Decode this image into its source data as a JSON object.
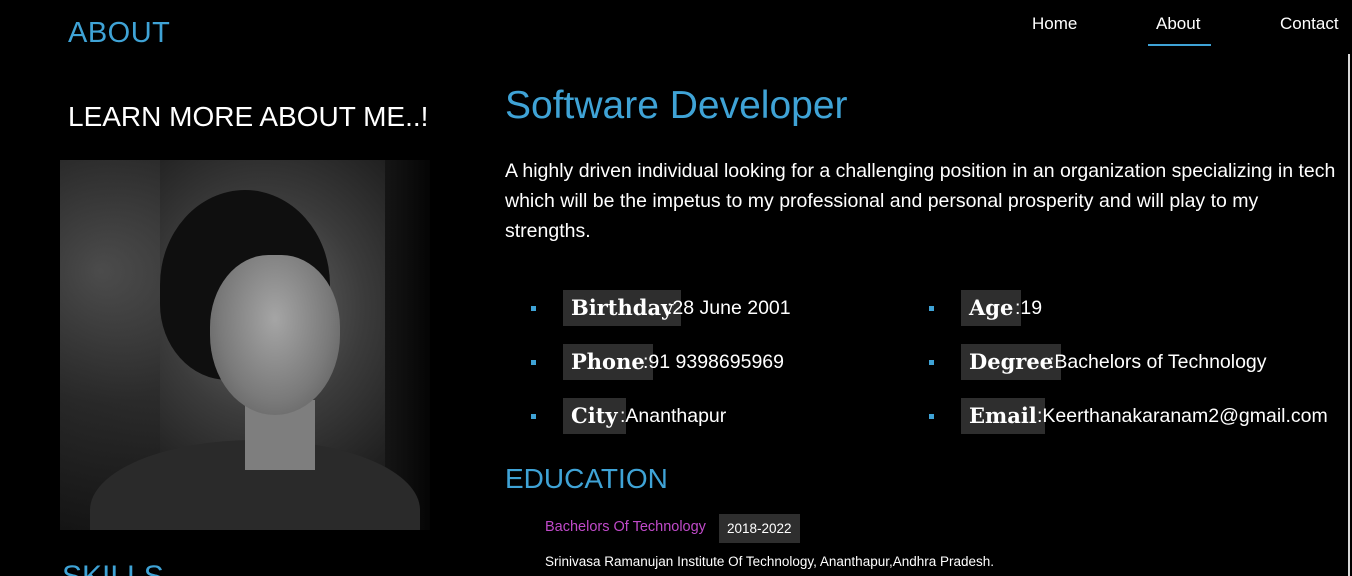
{
  "header": {
    "section_title": "ABOUT",
    "nav": {
      "home": "Home",
      "about": "About",
      "contact": "Contact",
      "active": "About"
    }
  },
  "left": {
    "heading": "LEARN MORE ABOUT ME..!",
    "photo_alt": "profile-photo",
    "skills_title": "SKILLS"
  },
  "main": {
    "role": "Software Developer",
    "summary": "A highly driven individual looking for a challenging position in an organization specializing in tech which will be the impetus to my professional and personal prosperity and will play to my strengths.",
    "info": {
      "birthday": {
        "label": "Birthday",
        "value": ":28 June 2001"
      },
      "age": {
        "label": "Age",
        "value": ":19"
      },
      "phone": {
        "label": "Phone",
        "value": ":91 9398695969"
      },
      "degree": {
        "label": "Degree",
        "value": ":Bachelors of Technology"
      },
      "city": {
        "label": "City",
        "value": ":Ananthapur"
      },
      "email": {
        "label": "Email",
        "value": ":Keerthanakaranam2@gmail.com"
      }
    }
  },
  "education": {
    "title": "EDUCATION",
    "items": [
      {
        "degree": "Bachelors Of Technology",
        "years": "2018-2022",
        "institution": "Srinivasa Ramanujan Institute Of Technology, Ananthapur,Andhra Pradesh."
      }
    ]
  },
  "colors": {
    "accent": "#3fa3d6",
    "degree_text": "#c04ac9",
    "label_bg": "#2e2e2e",
    "background": "#000000"
  }
}
